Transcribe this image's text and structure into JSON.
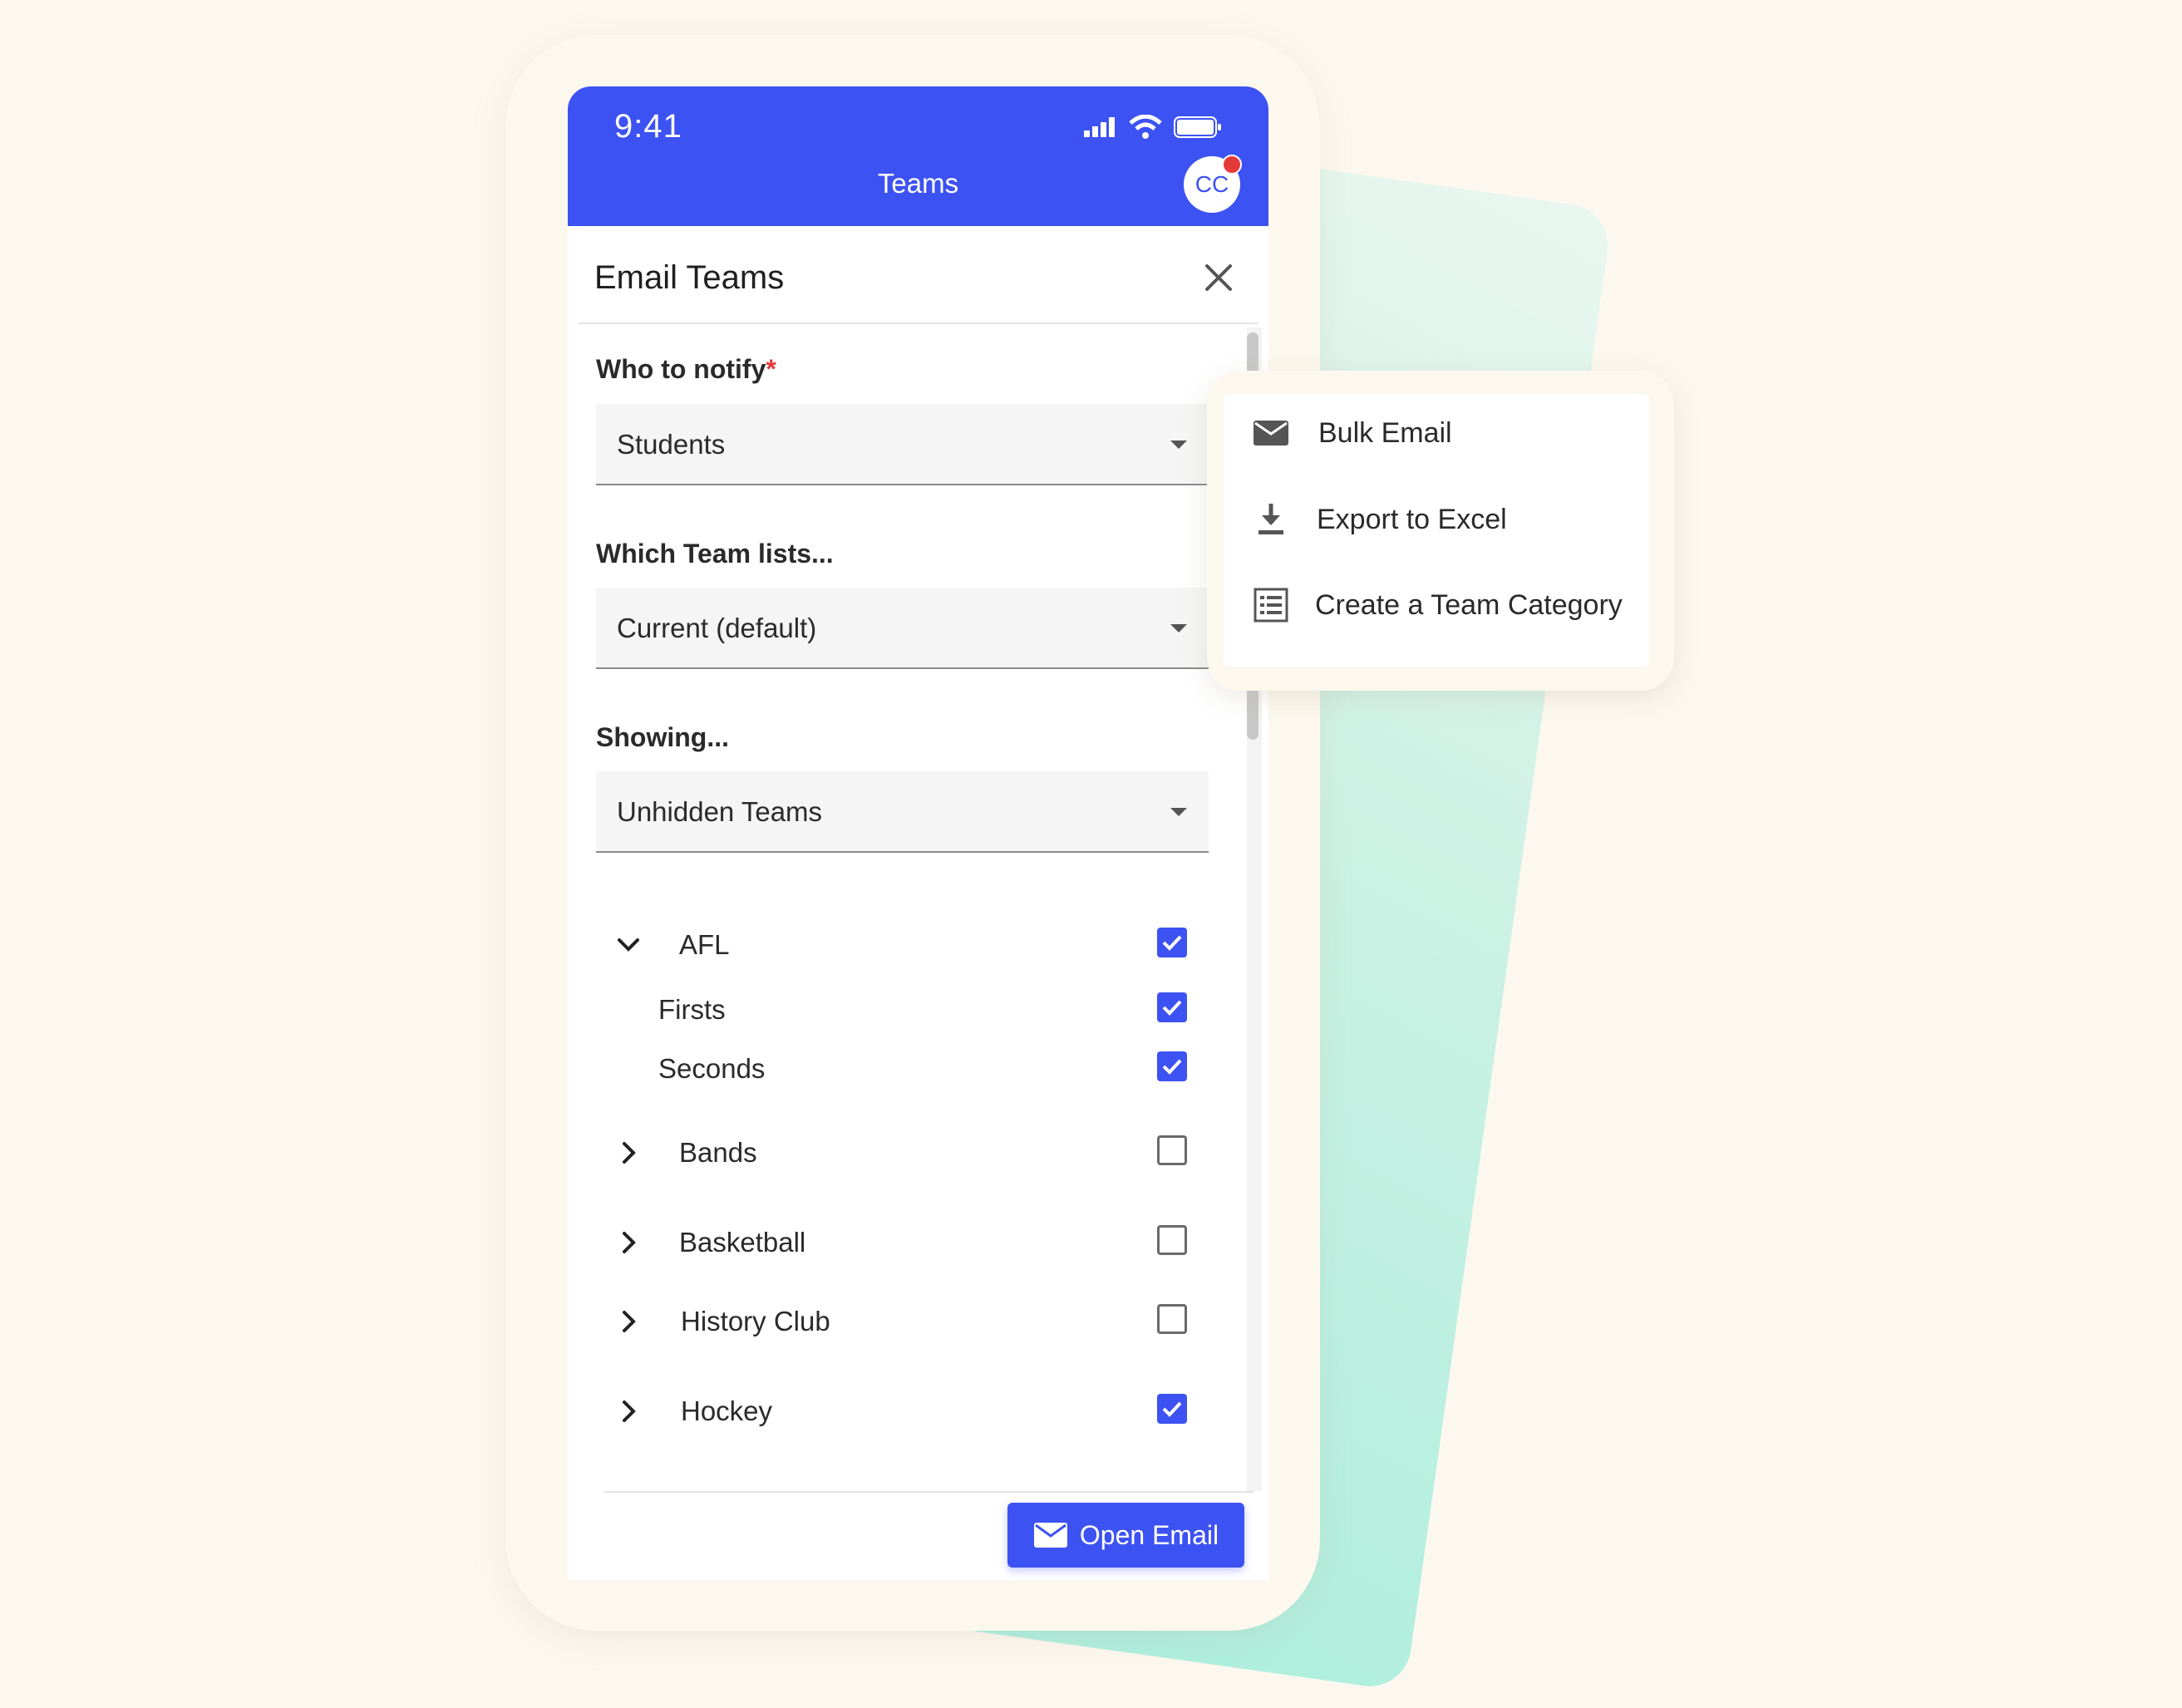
{
  "status_bar": {
    "time": "9:41"
  },
  "appbar": {
    "title": "Teams",
    "avatar_initials": "CC"
  },
  "dialog": {
    "title": "Email Teams"
  },
  "fields": [
    {
      "label": "Who to notify",
      "required_mark": "*",
      "value": "Students"
    },
    {
      "label": "Which Team lists...",
      "value": "Current (default)"
    },
    {
      "label": "Showing...",
      "value": "Unhidden Teams"
    }
  ],
  "teams": [
    {
      "label": "AFL",
      "expanded": true,
      "checked": true
    },
    {
      "label": "Firsts",
      "child": true,
      "checked": true
    },
    {
      "label": "Seconds",
      "child": true,
      "checked": true
    },
    {
      "label": "Bands",
      "expanded": false,
      "checked": false
    },
    {
      "label": "Basketball",
      "expanded": false,
      "checked": false
    },
    {
      "label": "History Club",
      "expanded": false,
      "checked": false
    },
    {
      "label": "Hockey",
      "expanded": false,
      "checked": true
    }
  ],
  "footer": {
    "open_email_label": "Open Email"
  },
  "menu": {
    "items": [
      {
        "label": "Bulk Email",
        "icon": "envelope-icon"
      },
      {
        "label": "Export to Excel",
        "icon": "download-icon"
      },
      {
        "label": "Create a Team Category",
        "icon": "list-icon"
      }
    ]
  },
  "colors": {
    "primary": "#3d52f2",
    "background": "#fdf8ef",
    "accent_mint": "#a8eedc",
    "required": "#e53a3a"
  }
}
